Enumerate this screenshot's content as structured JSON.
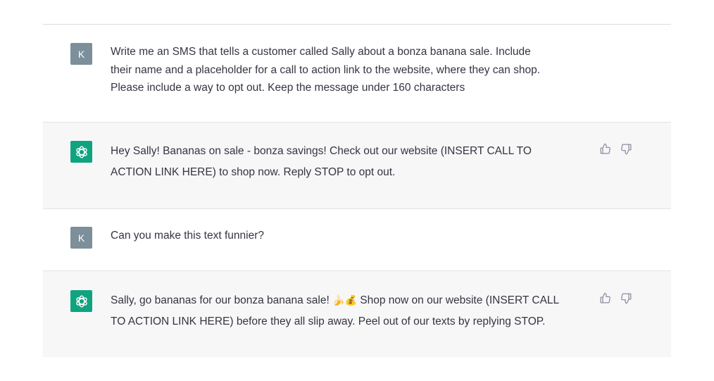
{
  "conversation": {
    "messages": [
      {
        "role": "user",
        "avatar_letter": "K",
        "lines": [
          "Write me an SMS that tells a customer called Sally about a bonza banana sale. Include",
          "their name and a placeholder for a call to action link to the website, where they can shop.",
          "Please include a way to opt out. Keep the message under 160 characters"
        ]
      },
      {
        "role": "assistant",
        "avatar_icon": "openai-logo-icon",
        "lines": [
          "Hey Sally! Bananas on sale - bonza savings! Check out our website (INSERT CALL TO",
          "ACTION LINK HERE) to shop now. Reply STOP to opt out."
        ]
      },
      {
        "role": "user",
        "avatar_letter": "K",
        "lines": [
          "Can you make this text funnier?"
        ]
      },
      {
        "role": "assistant",
        "avatar_icon": "openai-logo-icon",
        "line1_before": "Sally, go bananas for our bonza banana sale! ",
        "emojis": "🍌💰",
        "line1_after": " Shop now on our website (INSERT CALL",
        "line2": "TO ACTION LINK HERE) before they all slip away. Peel out of our texts by replying STOP."
      }
    ]
  },
  "icons": {
    "thumbs_up": "thumbs-up-icon",
    "thumbs_down": "thumbs-down-icon"
  },
  "colors": {
    "assistant_bg": "#f7f7f8",
    "user_avatar": "#7c8f9a",
    "bot_avatar": "#10a37f",
    "text": "#343541"
  }
}
